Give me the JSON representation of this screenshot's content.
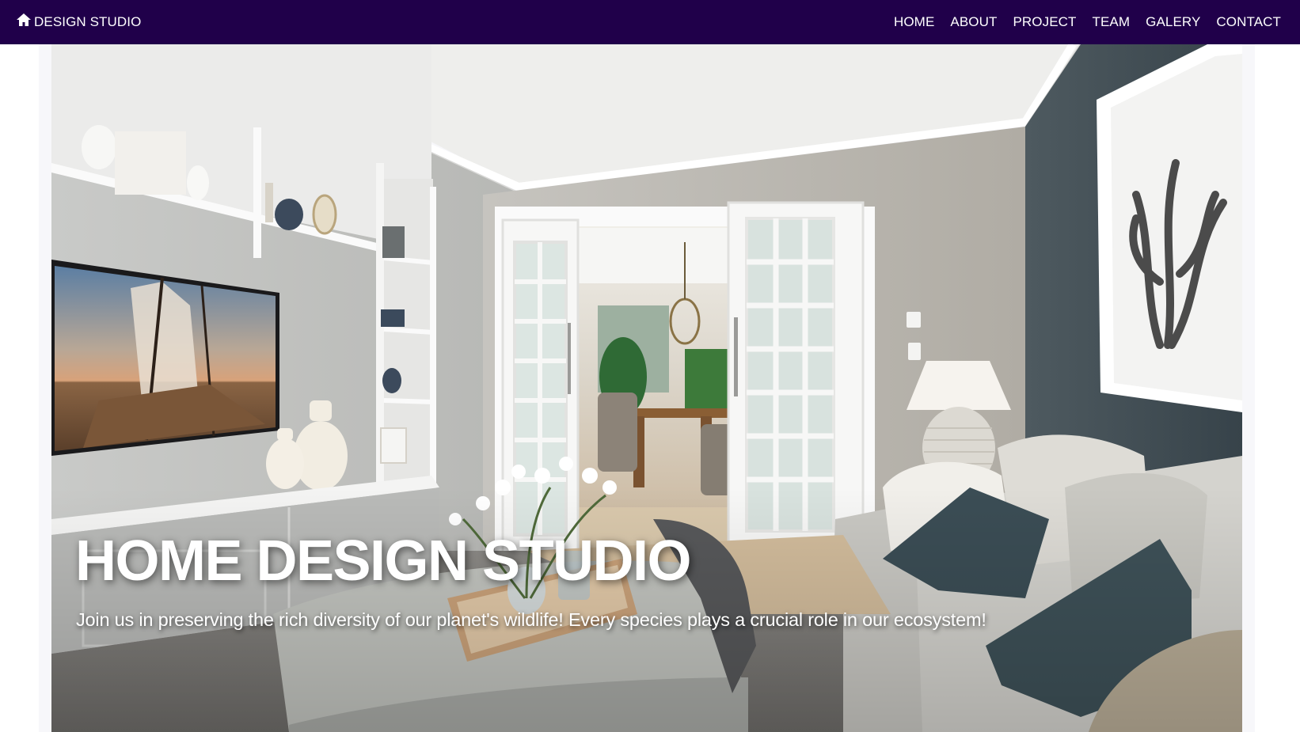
{
  "navbar": {
    "brand": {
      "icon": "home-icon",
      "label": "DESIGN STUDIO"
    },
    "links": [
      {
        "label": "HOME"
      },
      {
        "label": "ABOUT"
      },
      {
        "label": "PROJECT"
      },
      {
        "label": "TEAM"
      },
      {
        "label": "GALERY"
      },
      {
        "label": "CONTACT"
      }
    ],
    "background_color": "#20004a",
    "text_color": "#ffffff"
  },
  "hero": {
    "title": "HOME DESIGN STUDIO",
    "subtitle": "Join us in preserving the rich diversity of our planet's wildlife! Every species plays a crucial role in our ecosystem!",
    "image": "living-room-interior-photo"
  }
}
